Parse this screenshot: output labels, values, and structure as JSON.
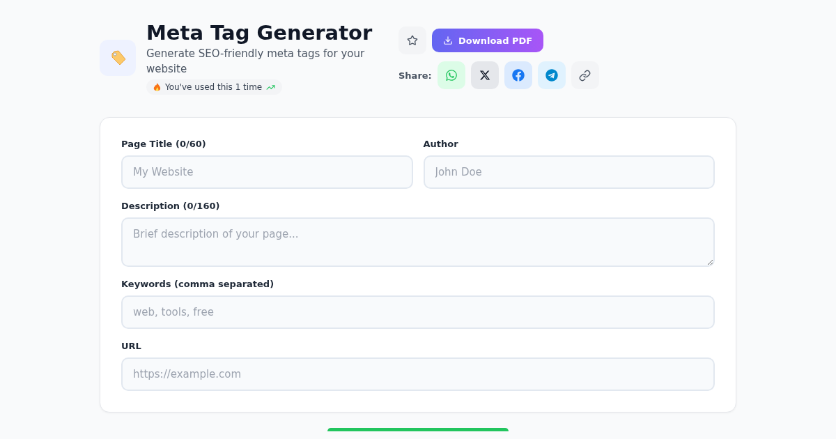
{
  "header": {
    "title": "Meta Tag Generator",
    "subtitle": "Generate SEO-friendly meta tags for your website",
    "usage": "You've used this 1 time"
  },
  "actions": {
    "download": "Download PDF",
    "share_label": "Share:",
    "share": [
      {
        "kind": "whatsapp"
      },
      {
        "kind": "x"
      },
      {
        "kind": "facebook"
      },
      {
        "kind": "telegram"
      },
      {
        "kind": "link"
      }
    ]
  },
  "form": {
    "rows": [
      [
        {
          "label": "Page Title (0/60)",
          "kind": "input",
          "placeholder": "My Website"
        },
        {
          "label": "Author",
          "kind": "input",
          "placeholder": "John Doe"
        }
      ],
      [
        {
          "label": "Description (0/160)",
          "kind": "textarea",
          "placeholder": "Brief description of your page..."
        }
      ],
      [
        {
          "label": "Keywords (comma separated)",
          "kind": "input",
          "placeholder": "web, tools, free"
        }
      ],
      [
        {
          "label": "URL",
          "kind": "input",
          "placeholder": "https://example.com"
        }
      ]
    ]
  }
}
